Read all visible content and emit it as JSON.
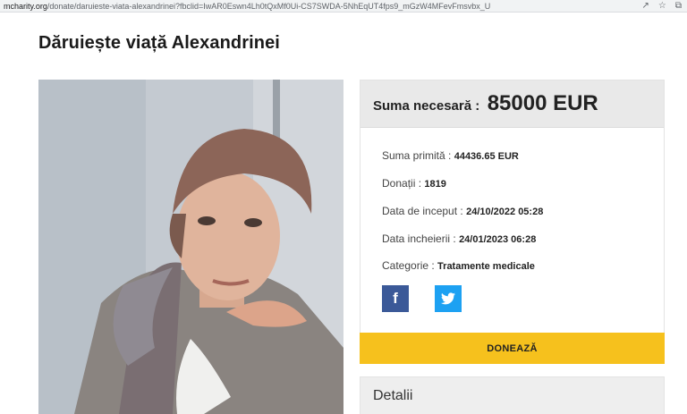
{
  "browser": {
    "url_domain": "mcharity.org",
    "url_path": "/donate/daruieste-viata-alexandrinei?fbclid=IwAR0Eswn4Lh0tQxMf0Ui-CS7SWDA-5NhEqUT4fps9_mGzW4MFevFmsvbx_U"
  },
  "page": {
    "title": "Dăruiește viață Alexandrinei"
  },
  "campaign": {
    "goal_label": "Suma necesară :",
    "goal_value": "85000 EUR",
    "received_label": "Suma primită :",
    "received_value": "44436.65 EUR",
    "donations_label": "Donații :",
    "donations_value": "1819",
    "start_label": "Data de inceput :",
    "start_value": "24/10/2022 05:28",
    "end_label": "Data incheierii :",
    "end_value": "24/01/2023 06:28",
    "category_label": "Categorie :",
    "category_value": "Tratamente medicale"
  },
  "share": {
    "facebook_icon": "f",
    "twitter_icon": "twitter-bird"
  },
  "donate_button": "DONEAZĂ",
  "details_label": "Detalii",
  "colors": {
    "accent_yellow": "#f6c11d",
    "facebook_blue": "#3b5998",
    "twitter_blue": "#1da1f2",
    "header_gray": "#e9e9e9"
  }
}
